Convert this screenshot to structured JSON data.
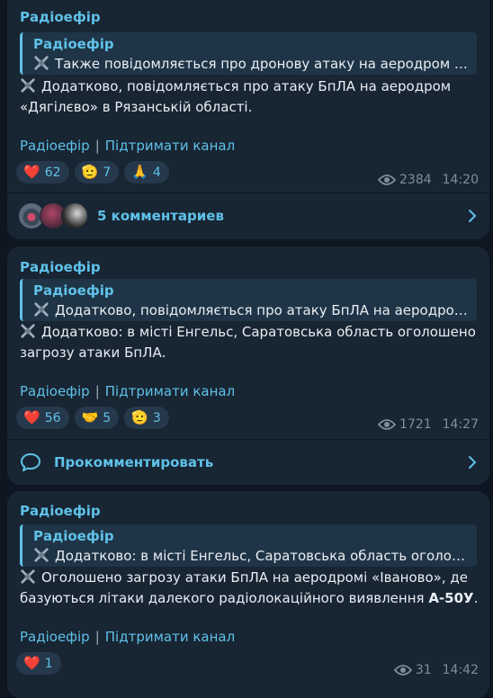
{
  "messages": [
    {
      "author": "Радіоефір",
      "quote_author": "Радіоефір",
      "quote_text": "Также повідомляється про дронову атаку на аеродром «...",
      "body_line1": "Додатково, повідомляється про атаку БпЛА на аеродром",
      "body_line2": "«Дягілєво» в Рязанській області.",
      "link1": "Радіоефір",
      "link_sep": "|",
      "link2": "Підтримати канал",
      "reactions": [
        {
          "emoji": "❤️",
          "count": "62"
        },
        {
          "emoji": "🫡",
          "count": "7"
        },
        {
          "emoji": "🙏",
          "count": "4"
        }
      ],
      "views": "2384",
      "time": "14:20",
      "comments_label": "5 комментариев"
    },
    {
      "author": "Радіоефір",
      "quote_author": "Радіоефір",
      "quote_text": "Додатково, повідомляється про атаку БпЛА на аеродром ...",
      "body_line1": "Додатково: в місті Енгельс, Саратовська область оголошено",
      "body_line2": "загрозу атаки БпЛА.",
      "link1": "Радіоефір",
      "link_sep": "|",
      "link2": "Підтримати канал",
      "reactions": [
        {
          "emoji": "❤️",
          "count": "56"
        },
        {
          "emoji": "🤝",
          "count": "5"
        },
        {
          "emoji": "🫡",
          "count": "3"
        }
      ],
      "views": "1721",
      "time": "14:27",
      "comment_action": "Прокомментировать"
    },
    {
      "author": "Радіоефір",
      "quote_author": "Радіоефір",
      "quote_text": "Додатково: в місті Енгельс, Саратовська область оголош...",
      "body_line1": "Оголошено загрозу атаки БпЛА на аеродромі «Іваново», де",
      "body_line2_prefix": "базуються літаки далекого радіолокаційного виявлення ",
      "body_line2_bold": "А-50У",
      "body_line2_suffix": ".",
      "link1": "Радіоефір",
      "link_sep": "|",
      "link2": "Підтримати канал",
      "reactions": [
        {
          "emoji": "❤️",
          "count": "1"
        }
      ],
      "views": "31",
      "time": "14:42"
    }
  ],
  "colors": {
    "background": "#0e1621",
    "bubble": "#182533",
    "accent": "#5fc1e8",
    "muted": "#7f8e9c"
  },
  "icons": {
    "drone": "drone-icon",
    "views": "eye-icon",
    "chevron": "chevron-right-icon",
    "comment": "comment-bubble-icon"
  }
}
